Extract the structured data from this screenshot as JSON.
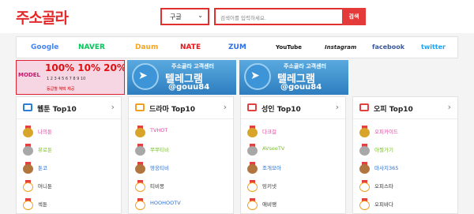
{
  "header": {
    "logo": "주소골라",
    "select_value": "구글",
    "search_placeholder": "검색어를 입력하세요.",
    "search_button": "검색"
  },
  "partners": [
    {
      "label": "Google",
      "color": "#4285f4"
    },
    {
      "label": "NAVER",
      "color": "#03c75a"
    },
    {
      "label": "Daum",
      "color": "#f5a623"
    },
    {
      "label": "NATE",
      "color": "#e8161b"
    },
    {
      "label": "ZUM",
      "color": "#2e6ee8"
    },
    {
      "label": "YouTube",
      "color": "#111111"
    },
    {
      "label": "Instagram",
      "color": "#222222"
    },
    {
      "label": "facebook",
      "color": "#3b5998"
    },
    {
      "label": "twitter",
      "color": "#1da1f2"
    }
  ],
  "banners": {
    "model": {
      "tag": "MODEL",
      "big": "100% 10% 20%",
      "row": "1 2 3 4 5 6 7 8 9 10",
      "row2": "등급별 혜택 제공"
    },
    "tele1": {
      "line1": "주소골라 고객센터",
      "line2": "텔레그램",
      "line3": "@gouu84"
    },
    "tele2": {
      "line1": "주소골라 고객센터",
      "line2": "텔레그램",
      "line3": "@gouu84"
    }
  },
  "cards": [
    {
      "title": "웹툰 Top10",
      "icon": "book-icon",
      "icon_color": "#2a7fd4",
      "items": [
        {
          "name": "나의툰",
          "color": "#e0479e"
        },
        {
          "name": "뮤로툰",
          "color": "#7bbf2a"
        },
        {
          "name": "툰코",
          "color": "#2a6fd0"
        },
        {
          "name": "머니툰",
          "color": "#333333"
        },
        {
          "name": "섹툰",
          "color": "#333333"
        }
      ]
    },
    {
      "title": "드라마 Top10",
      "icon": "clapper-icon",
      "icon_color": "#f0a020",
      "items": [
        {
          "name": "TVHOT",
          "color": "#e0479e"
        },
        {
          "name": "쭈쭈티비",
          "color": "#7bbf2a"
        },
        {
          "name": "영웅티비",
          "color": "#2a6fd0"
        },
        {
          "name": "티비몽",
          "color": "#333333"
        },
        {
          "name": "HOOHOOTV",
          "color": "#2a6fd0"
        }
      ]
    },
    {
      "title": "성인 Top10",
      "icon": "adult-icon",
      "icon_color": "#e34040",
      "items": [
        {
          "name": "다크걸",
          "color": "#e0479e"
        },
        {
          "name": "AVseeTV",
          "color": "#7bbf2a"
        },
        {
          "name": "조개모아",
          "color": "#2a6fd0"
        },
        {
          "name": "밍키넷",
          "color": "#333333"
        },
        {
          "name": "애비땡",
          "color": "#333333"
        }
      ]
    },
    {
      "title": "오피 Top10",
      "icon": "ticket-icon",
      "icon_color": "#e34040",
      "items": [
        {
          "name": "오피카이드",
          "color": "#e0479e"
        },
        {
          "name": "아찔가기",
          "color": "#7bbf2a"
        },
        {
          "name": "마사지365",
          "color": "#2a6fd0"
        },
        {
          "name": "오피스타",
          "color": "#333333"
        },
        {
          "name": "오피바다",
          "color": "#333333"
        }
      ]
    }
  ],
  "medal_labels": [
    "",
    "",
    "",
    "4",
    "5"
  ],
  "arrow_glyph": "›"
}
